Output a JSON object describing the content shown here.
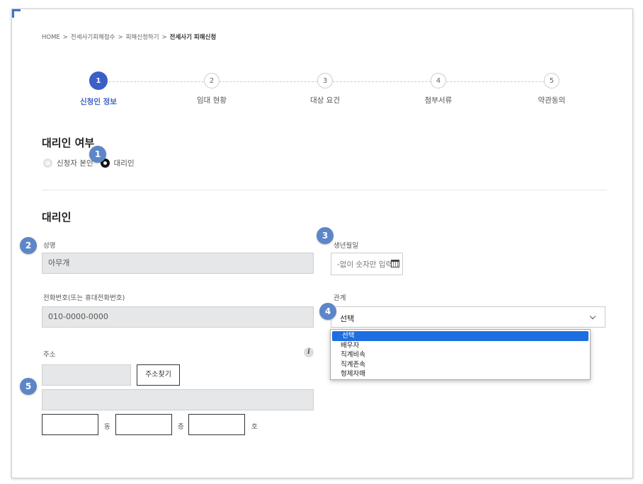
{
  "breadcrumb": {
    "items": [
      "HOME",
      "전세사기피해접수",
      "피해신청하기"
    ],
    "current": "전세사기 피해신청",
    "separator": ">"
  },
  "steps": [
    {
      "num": "1",
      "label": "신청인 정보",
      "active": true
    },
    {
      "num": "2",
      "label": "임대 현황"
    },
    {
      "num": "3",
      "label": "대상 요건"
    },
    {
      "num": "4",
      "label": "첨부서류"
    },
    {
      "num": "5",
      "label": "약관동의"
    }
  ],
  "proxy_section": {
    "title": "대리인 여부",
    "options": [
      "신청자 본인",
      "대리인"
    ],
    "selected": "대리인"
  },
  "form": {
    "title": "대리인",
    "name_label": "성명",
    "name_placeholder": "아무개",
    "birth_label": "생년월일",
    "birth_placeholder": "-없이 숫자만 입력",
    "phone_label": "전화번호(또는 휴대전화번호)",
    "phone_placeholder": "010-0000-0000",
    "relation_label": "관계",
    "relation_value": "선택",
    "relation_options": [
      "선택",
      "배우자",
      "직계비속",
      "직계존속",
      "형제자매"
    ],
    "address_label": "주소",
    "address_search_button": "주소찾기",
    "info_icon": "i",
    "unit_dong": "동",
    "unit_cheung": "층",
    "unit_ho": "호"
  },
  "annotations": [
    "1",
    "2",
    "3",
    "4",
    "5"
  ],
  "colors": {
    "accent": "#3b5fc6",
    "badge": "#5c86c8",
    "dropdown_selected": "#1d6ee0"
  }
}
